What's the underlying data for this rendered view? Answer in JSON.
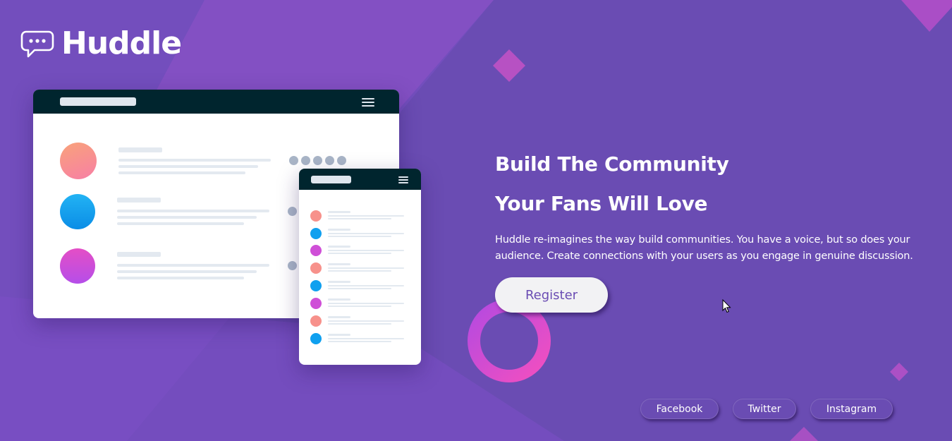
{
  "brand": {
    "name": "Huddle",
    "icon": "chat-bubble-icon"
  },
  "hero": {
    "title_line1": "Build The Community",
    "title_line2": "Your Fans Will Love",
    "description": "Huddle re-imagines the way build communities. You have a voice, but so does your audience. Create connections with your users as you engage in genuine discussion."
  },
  "cta": {
    "register_label": "Register"
  },
  "social": {
    "facebook": "Facebook",
    "twitter": "Twitter",
    "instagram": "Instagram"
  },
  "colors": {
    "background": "#6a4cb3",
    "accent_pink": "#e94fc3",
    "nav_dark": "#00252e",
    "button_text": "#6a4cb3"
  }
}
